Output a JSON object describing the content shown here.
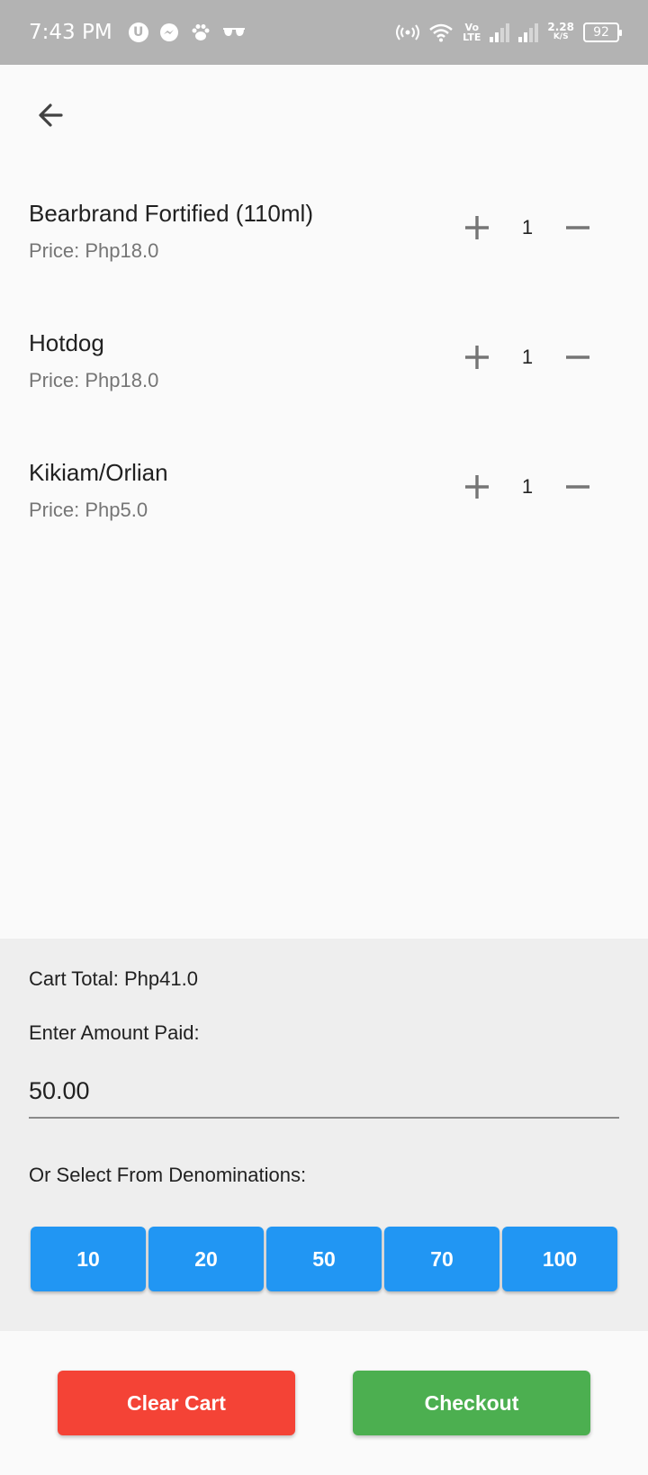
{
  "status_bar": {
    "time": "7:43 PM",
    "left_icons": [
      "u-circle-icon",
      "messenger-icon",
      "paw-icon",
      "sunglasses-icon"
    ],
    "vo_top": "Vo",
    "vo_bottom": "LTE",
    "speed_value": "2.28",
    "speed_unit": "K/S",
    "battery": "92"
  },
  "header": {
    "back_icon": "arrow-left-icon"
  },
  "cart": {
    "items": [
      {
        "name": "Bearbrand Fortified (110ml)",
        "price": "Price: Php18.0",
        "qty": "1"
      },
      {
        "name": "Hotdog",
        "price": "Price: Php18.0",
        "qty": "1"
      },
      {
        "name": "Kikiam/Orlian",
        "price": "Price: Php5.0",
        "qty": "1"
      }
    ]
  },
  "payment": {
    "cart_total": "Cart Total: Php41.0",
    "amount_label": "Enter Amount Paid:",
    "amount_value": "50.00",
    "denominations_label": "Or Select From Denominations:",
    "denominations": [
      "10",
      "20",
      "50",
      "70",
      "100"
    ],
    "denomination_color": "#2196f3"
  },
  "actions": {
    "clear_label": "Clear Cart",
    "clear_color": "#f44336",
    "checkout_label": "Checkout",
    "checkout_color": "#4caf50"
  }
}
